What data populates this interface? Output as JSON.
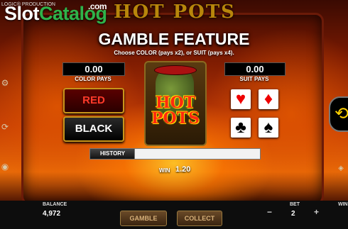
{
  "watermark": {
    "part1": "Slot",
    "part2": "Catalog",
    "suffix": ".com"
  },
  "header": {
    "provider": "LOGIC® PRODUCTION",
    "game_logo": "HOT POTS"
  },
  "gamble": {
    "title": "GAMBLE FEATURE",
    "subtitle": "Choose COLOR (pays x2), or SUIT (pays x4).",
    "color_pays": {
      "value": "0.00",
      "label": "COLOR PAYS"
    },
    "suit_pays": {
      "value": "0.00",
      "label": "SUIT PAYS"
    },
    "buttons": {
      "red": "RED",
      "black": "BLACK"
    },
    "card": {
      "name": "HOT POTS"
    },
    "suits": [
      {
        "symbol": "♥",
        "name": "hearts",
        "color": "#e00000"
      },
      {
        "symbol": "♦",
        "name": "diamonds",
        "color": "#e00000"
      },
      {
        "symbol": "♣",
        "name": "clubs",
        "color": "#000000"
      },
      {
        "symbol": "♠",
        "name": "spades",
        "color": "#000000"
      }
    ],
    "history_label": "HISTORY",
    "win_label": "WIN",
    "win_value": "1.20"
  },
  "bottom_bar": {
    "balance_label": "BALANCE",
    "balance_value": "4,972",
    "gamble_button": "GAMBLE",
    "collect_button": "COLLECT",
    "bet_label": "BET",
    "bet_value": "2",
    "minus": "−",
    "plus": "+",
    "win_label": "WIN"
  },
  "colors": {
    "accent_gold": "#c8951a",
    "spin_yellow": "#ffd000"
  }
}
